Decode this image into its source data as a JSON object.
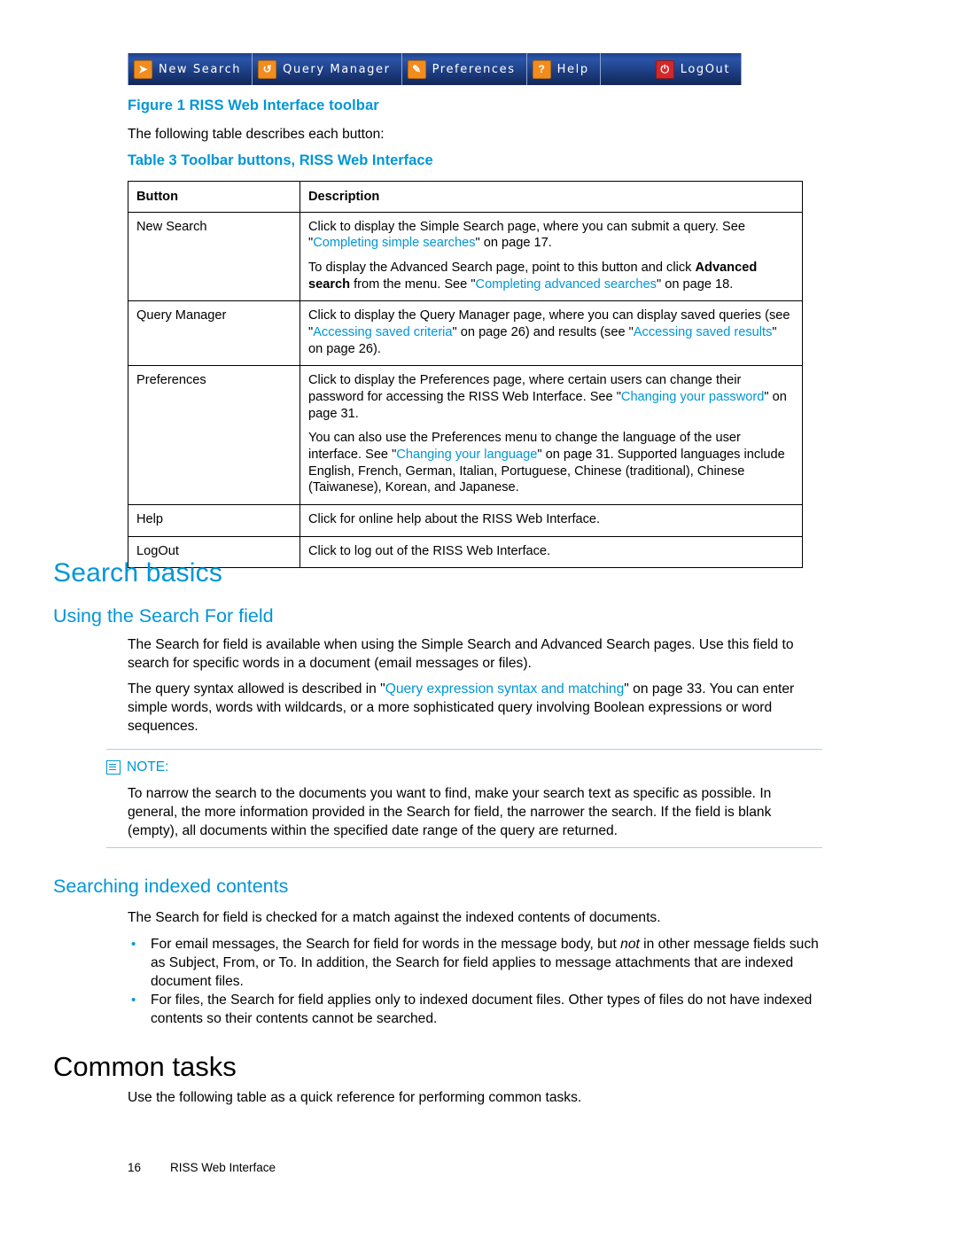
{
  "toolbar": {
    "buttons": [
      {
        "icon": "arrow-right-icon",
        "glyph": "➜",
        "label": "New Search",
        "icon_color": "#f28c1e"
      },
      {
        "icon": "refresh-icon",
        "glyph": "↺",
        "label": "Query Manager",
        "icon_color": "#f28c1e"
      },
      {
        "icon": "pencil-icon",
        "glyph": "✎",
        "label": "Preferences",
        "icon_color": "#f28c1e"
      },
      {
        "icon": "question-icon",
        "glyph": "?",
        "label": "Help",
        "icon_color": "#f28c1e"
      },
      {
        "icon": "power-icon",
        "glyph": "⏻",
        "label": "LogOut",
        "icon_color": "#d2272b"
      }
    ]
  },
  "figure": {
    "caption": "Figure 1 RISS Web Interface toolbar"
  },
  "intro": {
    "line": "The following table describes each button:"
  },
  "table": {
    "caption": "Table 3 Toolbar buttons, RISS Web Interface",
    "headers": [
      "Button",
      "Description"
    ],
    "rows": [
      {
        "button": "New Search",
        "paragraphs": [
          {
            "parts": [
              {
                "t": "Click to display the Simple Search page, where you can submit a query. See \"",
                "s": "plain"
              },
              {
                "t": "Completing simple searches",
                "s": "link"
              },
              {
                "t": "\" on page 17.",
                "s": "plain"
              }
            ]
          },
          {
            "parts": [
              {
                "t": "To display the Advanced Search page, point to this button and click ",
                "s": "plain"
              },
              {
                "t": "Advanced search",
                "s": "bold"
              },
              {
                "t": " from the menu. See \"",
                "s": "plain"
              },
              {
                "t": "Completing advanced searches",
                "s": "link"
              },
              {
                "t": "\" on page 18.",
                "s": "plain"
              }
            ]
          }
        ]
      },
      {
        "button": "Query Manager",
        "paragraphs": [
          {
            "parts": [
              {
                "t": "Click to display the Query Manager page, where you can display saved queries (see \"",
                "s": "plain"
              },
              {
                "t": "Accessing saved criteria",
                "s": "link"
              },
              {
                "t": "\" on page 26) and results (see \"",
                "s": "plain"
              },
              {
                "t": "Accessing saved results",
                "s": "link"
              },
              {
                "t": "\" on page 26).",
                "s": "plain"
              }
            ]
          }
        ]
      },
      {
        "button": "Preferences",
        "paragraphs": [
          {
            "parts": [
              {
                "t": "Click to display the Preferences page, where certain users can change their password for accessing the RISS Web Interface. See \"",
                "s": "plain"
              },
              {
                "t": "Changing your password",
                "s": "link"
              },
              {
                "t": "\" on page 31.",
                "s": "plain"
              }
            ]
          },
          {
            "parts": [
              {
                "t": "You can also use the Preferences menu to change the language of the user interface. See \"",
                "s": "plain"
              },
              {
                "t": "Changing your language",
                "s": "link"
              },
              {
                "t": "\" on page 31. Supported languages include English, French, German, Italian, Portuguese, Chinese (traditional), Chinese (Taiwanese), Korean, and Japanese.",
                "s": "plain"
              }
            ]
          }
        ]
      },
      {
        "button": "Help",
        "paragraphs": [
          {
            "parts": [
              {
                "t": "Click for online help about the RISS Web Interface.",
                "s": "plain"
              }
            ]
          }
        ]
      },
      {
        "button": "LogOut",
        "paragraphs": [
          {
            "parts": [
              {
                "t": "Click to log out of the RISS Web Interface.",
                "s": "plain"
              }
            ]
          }
        ]
      }
    ]
  },
  "sections": {
    "search_basics": "Search basics",
    "using_search_for_field": "Using the Search For field",
    "searching_indexed_contents": "Searching indexed contents",
    "common_tasks": "Common tasks"
  },
  "paragraphs": {
    "p1": "The Search for field is available when using the Simple Search and Advanced Search pages. Use this field to search for specific words in a document (email messages or files).",
    "p2_a": "The query syntax allowed is described in \"",
    "p2_link": "Query expression syntax and matching",
    "p2_b": "\" on page 33. You can enter simple words, words with wildcards, or a more sophisticated query involving Boolean expressions or word sequences.",
    "p3": "The Search for field is checked for a match against the indexed contents of documents.",
    "p4": "Use the following table as a quick reference for performing common tasks."
  },
  "note": {
    "label": "NOTE:",
    "body": "To narrow the search to the documents you want to find, make your search text as specific as possible. In general, the more information provided in the Search for field, the narrower the search. If the field is blank (empty), all documents within the specified date range of the query are returned."
  },
  "bullets": [
    {
      "a": "For email messages, the Search for field for words in the message body, but ",
      "em": "not",
      "b": " in other message fields such as Subject, From, or To. In addition, the Search for field applies to message attachments that are indexed document files."
    },
    {
      "a": "For files, the Search for field applies only to indexed document files. Other types of files do not have indexed contents so their contents cannot be searched.",
      "em": "",
      "b": ""
    }
  ],
  "footer": {
    "page_number": "16",
    "text": "RISS Web Interface"
  }
}
